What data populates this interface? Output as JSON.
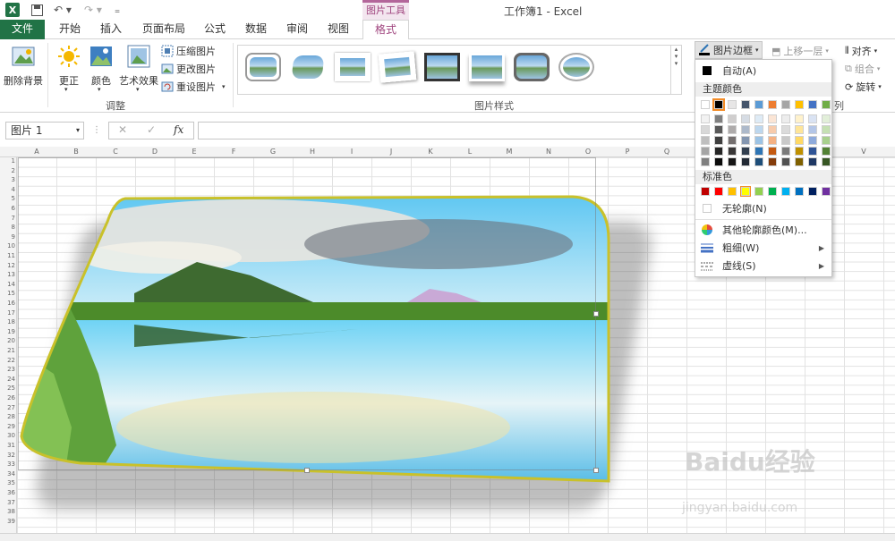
{
  "window": {
    "title": "工作簿1 - Excel",
    "contextual_tab_group": "图片工具"
  },
  "quick_access": {
    "save_icon": "save-icon",
    "undo_icon": "undo-icon",
    "redo_icon": "redo-icon",
    "customize_icon": "customize-icon"
  },
  "tabs": [
    {
      "label": "文件"
    },
    {
      "label": "开始"
    },
    {
      "label": "插入"
    },
    {
      "label": "页面布局"
    },
    {
      "label": "公式"
    },
    {
      "label": "数据"
    },
    {
      "label": "审阅"
    },
    {
      "label": "视图"
    },
    {
      "label": "格式"
    }
  ],
  "ribbon": {
    "remove_bg": "删除背景",
    "corrections": "更正",
    "color": "颜色",
    "artistic": "艺术效果",
    "compress": "压缩图片",
    "change_pic": "更改图片",
    "reset_pic": "重设图片",
    "group_adjust": "调整",
    "group_styles": "图片样式",
    "picture_border": "图片边框",
    "bring_forward": "上移一层",
    "align": "对齐",
    "group": "组合",
    "rotate": "旋转",
    "group_arrange_partial": "列"
  },
  "formula_bar": {
    "name_box": "图片 1",
    "cancel": "✕",
    "enter": "✓",
    "fx": "fx",
    "value": ""
  },
  "columns": [
    "A",
    "B",
    "C",
    "D",
    "E",
    "F",
    "G",
    "H",
    "I",
    "J",
    "K",
    "L",
    "M",
    "N",
    "O",
    "P",
    "Q",
    "R",
    "S",
    "T",
    "U",
    "V"
  ],
  "rows": [
    "1",
    "2",
    "3",
    "4",
    "5",
    "6",
    "7",
    "8",
    "9",
    "10",
    "11",
    "12",
    "13",
    "14",
    "15",
    "16",
    "17",
    "18",
    "19",
    "20",
    "21",
    "22",
    "23",
    "24",
    "25",
    "26",
    "27",
    "28",
    "29",
    "30",
    "31",
    "32",
    "33",
    "34",
    "35",
    "36",
    "37",
    "38",
    "39"
  ],
  "dropdown": {
    "auto": "自动(A)",
    "theme_colors_header": "主题颜色",
    "standard_colors_header": "标准色",
    "no_outline": "无轮廓(N)",
    "more_colors": "其他轮廓颜色(M)...",
    "weight": "粗细(W)",
    "dashes": "虚线(S)",
    "theme_top": [
      "#ffffff",
      "#000000",
      "#e7e6e6",
      "#44546a",
      "#5b9bd5",
      "#ed7d31",
      "#a5a5a5",
      "#ffc000",
      "#4472c4",
      "#70ad47"
    ],
    "theme_shades": [
      [
        "#f2f2f2",
        "#7f7f7f",
        "#d0cece",
        "#d6dce4",
        "#deebf6",
        "#fbe5d5",
        "#ededed",
        "#fff2cc",
        "#dae3f3",
        "#e2efd9"
      ],
      [
        "#d8d8d8",
        "#595959",
        "#aeabab",
        "#adb9ca",
        "#bdd7ee",
        "#f7cbac",
        "#dbdbdb",
        "#fee599",
        "#b4c6e7",
        "#c5e0b3"
      ],
      [
        "#bfbfbf",
        "#3f3f3f",
        "#757070",
        "#8496b0",
        "#9cc3e5",
        "#f4b183",
        "#c9c9c9",
        "#ffd965",
        "#8eaadb",
        "#a8d08d"
      ],
      [
        "#a5a5a5",
        "#262626",
        "#3a3838",
        "#323f4f",
        "#2e75b5",
        "#c55a11",
        "#7b7b7b",
        "#bf9000",
        "#2f5496",
        "#538135"
      ],
      [
        "#7f7f7f",
        "#0c0c0c",
        "#171616",
        "#222a35",
        "#1e4e79",
        "#843c0b",
        "#525252",
        "#7f6000",
        "#1f3864",
        "#375623"
      ]
    ],
    "standard": [
      "#c00000",
      "#ff0000",
      "#ffc000",
      "#ffff00",
      "#92d050",
      "#00b050",
      "#00b0f0",
      "#0070c0",
      "#002060",
      "#7030a0"
    ]
  },
  "colors": {
    "excel_green": "#217346",
    "context_purple": "#a0467f",
    "picture_frame": "#c9c12a"
  },
  "watermark": {
    "logo": "Baidu经验",
    "url": "jingyan.baidu.com"
  }
}
